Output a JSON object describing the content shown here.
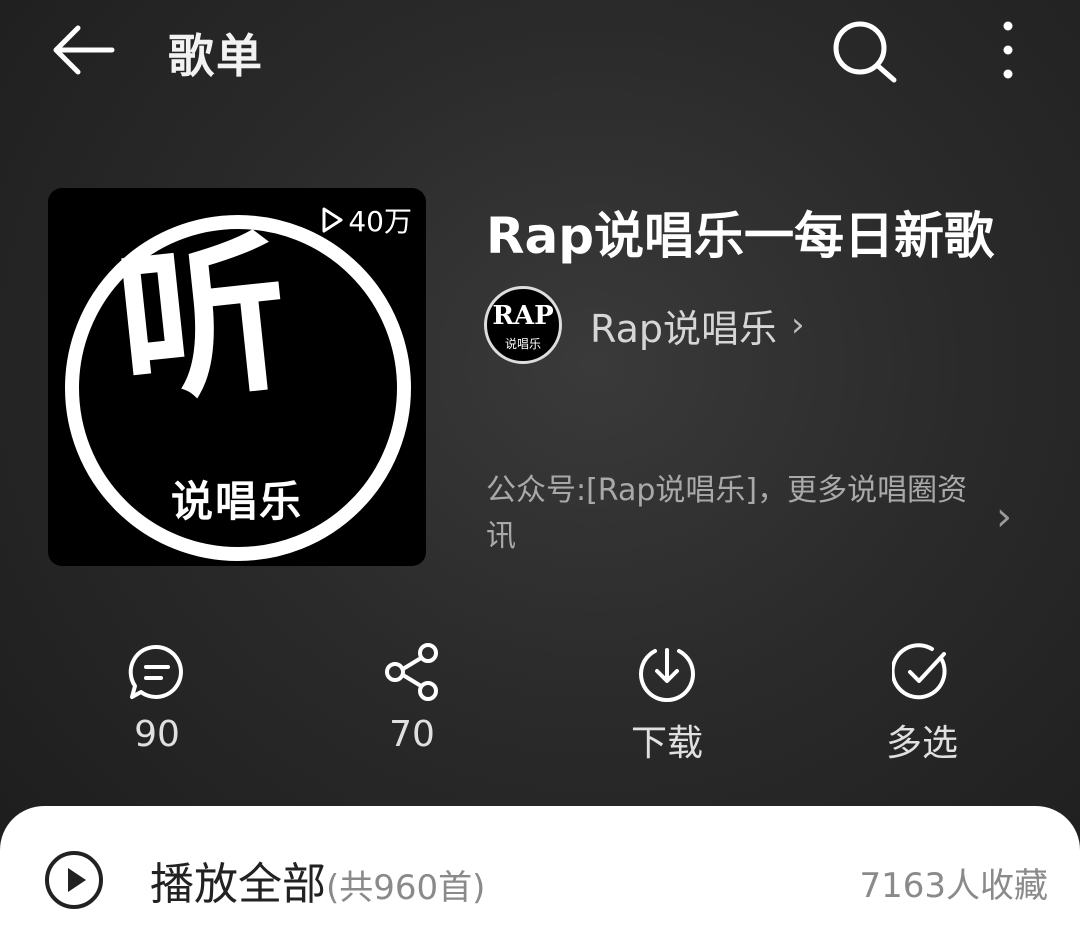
{
  "header": {
    "title": "歌单",
    "back_icon": "back-arrow-icon",
    "search_icon": "search-icon",
    "more_icon": "more-vertical-icon"
  },
  "cover": {
    "play_count": "40万",
    "logo_text": "说唱乐",
    "logo_glyph": "听"
  },
  "playlist": {
    "title": "Rap说唱乐一每日新歌",
    "creator_name": "Rap说唱乐",
    "creator_avatar_text": "RAP",
    "creator_avatar_sub": "说唱乐",
    "description": "公众号:[Rap说唱乐]，更多说唱圈资讯"
  },
  "actions": [
    {
      "label": "90",
      "icon": "comment-icon"
    },
    {
      "label": "70",
      "icon": "share-icon"
    },
    {
      "label": "下载",
      "icon": "download-icon"
    },
    {
      "label": "多选",
      "icon": "multi-select-icon"
    }
  ],
  "play_all": {
    "label": "播放全部",
    "count": "(共960首)",
    "favorites": "7163人收藏"
  },
  "colors": {
    "background": "#2a2a2a",
    "sheet": "#ffffff",
    "muted_text": "#8a8a8a"
  }
}
